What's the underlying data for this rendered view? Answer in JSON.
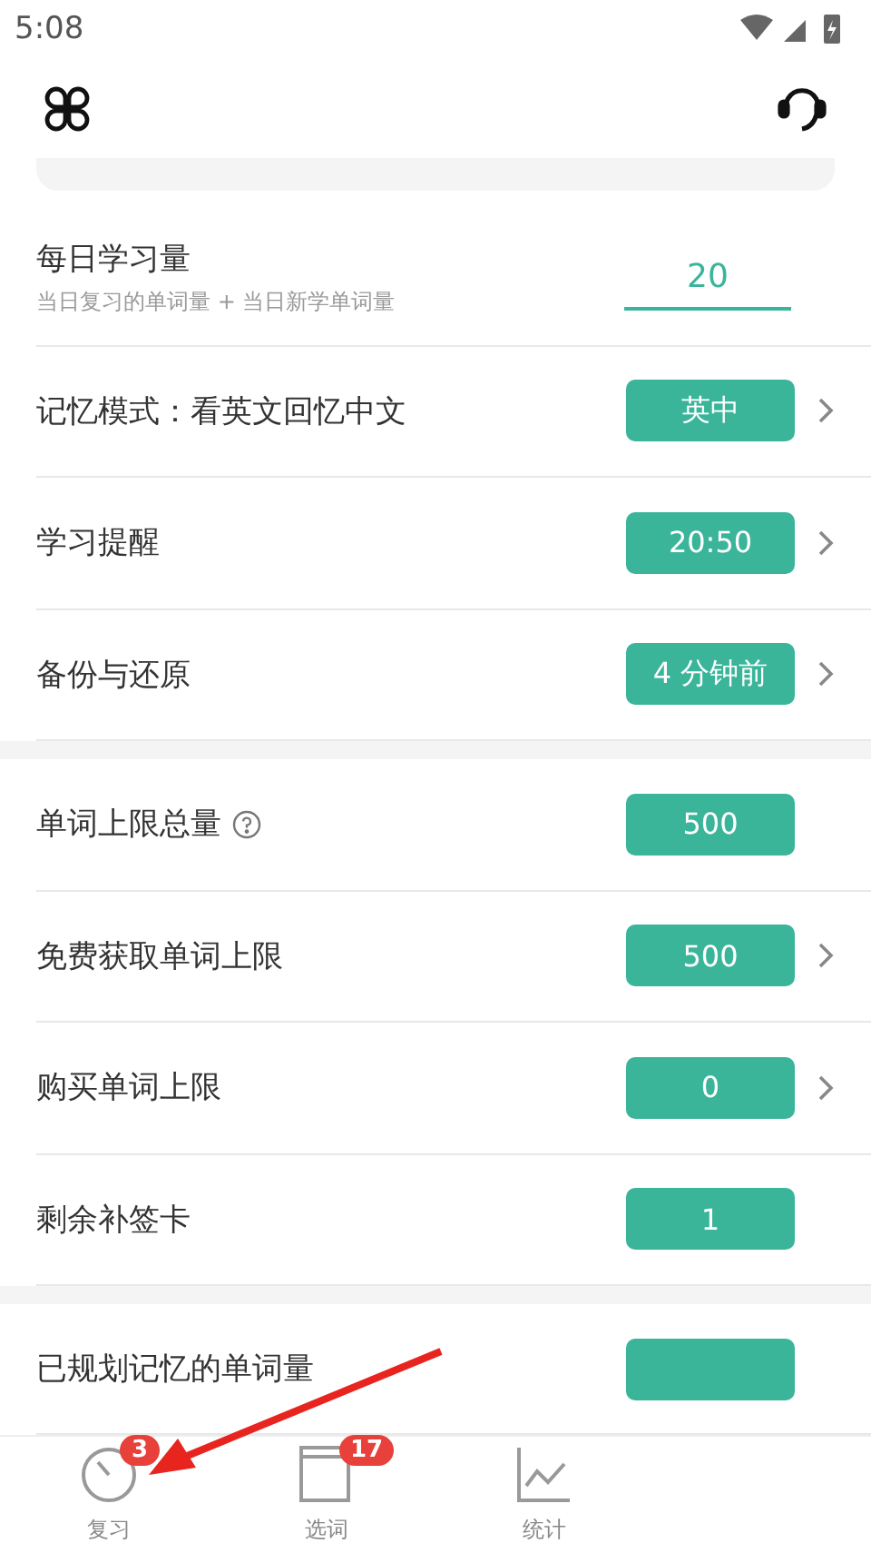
{
  "status_bar": {
    "time": "5:08"
  },
  "daily": {
    "title": "每日学习量",
    "subtitle": "当日复习的单词量 + 当日新学单词量",
    "value": "20"
  },
  "sections": [
    [
      {
        "label": "记忆模式：看英文回忆中文",
        "value": "英中",
        "chevron": true,
        "help": false
      },
      {
        "label": "学习提醒",
        "value": "20:50",
        "chevron": true,
        "help": false
      },
      {
        "label": "备份与还原",
        "value": "4 分钟前",
        "chevron": true,
        "help": false
      }
    ],
    [
      {
        "label": "单词上限总量",
        "value": "500",
        "chevron": false,
        "help": true
      },
      {
        "label": "免费获取单词上限",
        "value": "500",
        "chevron": true,
        "help": false
      },
      {
        "label": "购买单词上限",
        "value": "0",
        "chevron": true,
        "help": false
      },
      {
        "label": "剩余补签卡",
        "value": "1",
        "chevron": false,
        "help": false
      }
    ],
    [
      {
        "label": "已规划记忆的单词量",
        "chevron": false,
        "help": false
      }
    ]
  ],
  "bottom_nav": [
    {
      "label": "复习",
      "badge": "3"
    },
    {
      "label": "选词",
      "badge": "17"
    },
    {
      "label": "统计"
    }
  ]
}
